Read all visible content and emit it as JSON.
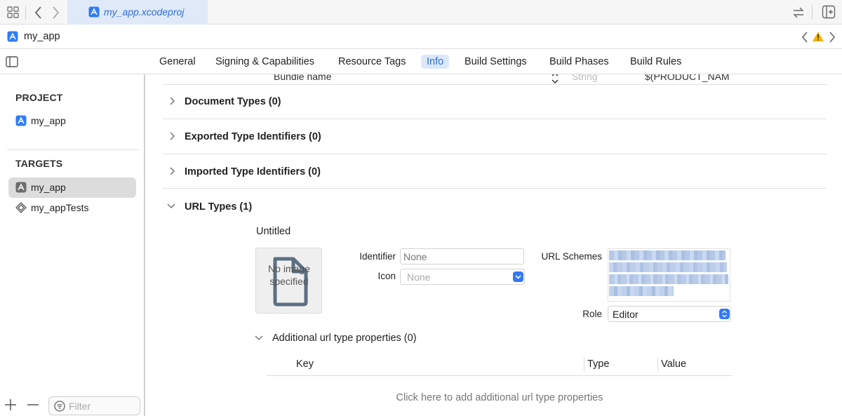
{
  "window": {
    "active_tab_label": "my_app.xcodeproj",
    "breadcrumb": "my_app"
  },
  "editor_tabs": [
    {
      "label": "General"
    },
    {
      "label": "Signing & Capabilities"
    },
    {
      "label": "Resource Tags"
    },
    {
      "label": "Info",
      "selected": true
    },
    {
      "label": "Build Settings"
    },
    {
      "label": "Build Phases"
    },
    {
      "label": "Build Rules"
    }
  ],
  "sidebar": {
    "project_header": "PROJECT",
    "project_item": "my_app",
    "targets_header": "TARGETS",
    "targets": [
      {
        "label": "my_app",
        "selected": true
      },
      {
        "label": "my_appTests"
      }
    ],
    "filter_placeholder": "Filter"
  },
  "partial_row": {
    "key": "Bundle name",
    "type": "String",
    "value": "$(PRODUCT_NAM"
  },
  "sections": {
    "document_types": "Document Types (0)",
    "exported_types": "Exported Type Identifiers (0)",
    "imported_types": "Imported Type Identifiers (0)",
    "url_types": "URL Types (1)"
  },
  "url_type": {
    "name": "Untitled",
    "image_placeholder": "No image specified",
    "identifier_label": "Identifier",
    "identifier_placeholder": "None",
    "icon_label": "Icon",
    "icon_value": "None",
    "url_schemes_label": "URL Schemes",
    "role_label": "Role",
    "role_value": "Editor"
  },
  "additional": {
    "title": "Additional url type properties (0)",
    "columns": [
      "Key",
      "Type",
      "Value"
    ],
    "add_hint": "Click here to add additional url type properties"
  },
  "colors": {
    "accent": "#3478f6",
    "selection_blue": "#dbe8fb",
    "warning": "#f4b400"
  }
}
